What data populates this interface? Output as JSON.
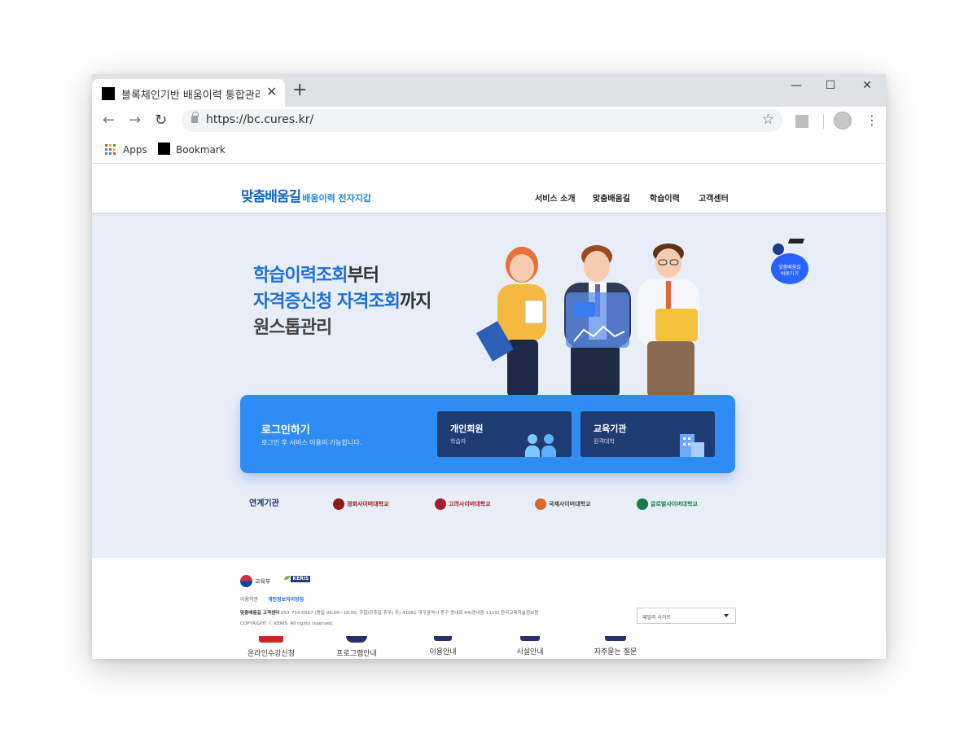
{
  "browser": {
    "tab_title": "블록체인기반 배움이력 통합관리 플",
    "tab_close": "✕",
    "new_tab": "+",
    "url": "https://bc.cures.kr/",
    "bookmarks": [
      "Apps",
      "Bookmark"
    ],
    "window_controls": [
      "—",
      "☐",
      "✕"
    ],
    "nav": {
      "back": "←",
      "forward": "→",
      "reload": "↻",
      "star": "☆",
      "menu": "⋮"
    }
  },
  "site": {
    "logo_main": "맞춤배움길",
    "logo_sub": "배움이력 전자지갑",
    "nav": [
      "서비스 소개",
      "맞춤배움길",
      "학습이력",
      "고객센터"
    ]
  },
  "hero": {
    "line1_bold": "학습이력조회",
    "line1_rest": "부터",
    "line2_bold": "자격증신청 자격조회",
    "line2_rest": "까지",
    "line3": "원스톱관리",
    "quick_badge": "맞춤배움길\n바로가기"
  },
  "login": {
    "title": "로그인하기",
    "desc": "로그인 후 서비스 이용이 가능합니다.",
    "cards": [
      {
        "title": "개인회원",
        "sub": "학습자"
      },
      {
        "title": "교육기관",
        "sub": "원격대학"
      }
    ]
  },
  "partners": {
    "label": "연계기관",
    "items": [
      {
        "name": "경희사이버대학교",
        "color": "#8b1c1c"
      },
      {
        "name": "고려사이버대학교",
        "color": "#a31d2a"
      },
      {
        "name": "국제사이버대학교",
        "color": "#d86a2e"
      },
      {
        "name": "글로벌사이버대학교",
        "color": "#1a7a4c"
      }
    ]
  },
  "footer": {
    "moe": "교육부",
    "keris": "KERIS",
    "links": [
      "이용약관",
      "개인정보처리방침"
    ],
    "info_bold": "맞춤배움길 고객센터",
    "info": "053-714-0567 (평일 09:00~18:00, 주말/공휴일 휴무) 우) 41061 대구광역시 동구 동내로 64(동내동 1119) 한국교육학술정보원",
    "copyright": "COPYRIGHT ⓒ KERIS. All rights reserved.",
    "family_site": "패밀리 사이트",
    "quick": [
      "온라인수강신청",
      "프로그램안내",
      "이용안내",
      "시설안내",
      "자주묻는 질문"
    ]
  }
}
